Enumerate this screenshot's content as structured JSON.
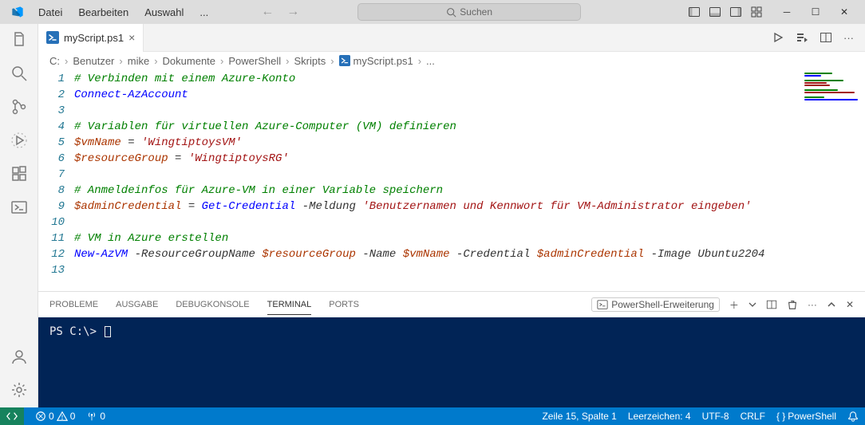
{
  "titlebar": {
    "menu": [
      "Datei",
      "Bearbeiten",
      "Auswahl",
      "..."
    ],
    "search": "Suchen"
  },
  "tab": {
    "filename": "myScript.ps1"
  },
  "breadcrumb": {
    "parts": [
      "C:",
      "Benutzer",
      "mike",
      "Dokumente",
      "PowerShell",
      "Skripts",
      "myScript.ps1",
      "..."
    ]
  },
  "code": {
    "lines": [
      {
        "n": 1,
        "tokens": [
          {
            "t": "# Verbinden mit einem Azure-Konto",
            "c": "tok-comment"
          }
        ]
      },
      {
        "n": 2,
        "tokens": [
          {
            "t": "Connect-AzAccount",
            "c": "tok-cmdlet"
          }
        ]
      },
      {
        "n": 3,
        "tokens": []
      },
      {
        "n": 4,
        "tokens": [
          {
            "t": "# Variablen für virtuellen Azure-Computer (VM) definieren",
            "c": "tok-comment"
          }
        ]
      },
      {
        "n": 5,
        "tokens": [
          {
            "t": "$vmName",
            "c": "tok-var"
          },
          {
            "t": " = ",
            "c": "tok-op"
          },
          {
            "t": "'WingtiptoysVM'",
            "c": "tok-string"
          }
        ]
      },
      {
        "n": 6,
        "tokens": [
          {
            "t": "$resourceGroup",
            "c": "tok-var"
          },
          {
            "t": " = ",
            "c": "tok-op"
          },
          {
            "t": "'WingtiptoysRG'",
            "c": "tok-string"
          }
        ]
      },
      {
        "n": 7,
        "tokens": []
      },
      {
        "n": 8,
        "tokens": [
          {
            "t": "# Anmeldeinfos für Azure-VM in einer Variable speichern",
            "c": "tok-comment"
          }
        ]
      },
      {
        "n": 9,
        "tokens": [
          {
            "t": "$adminCredential",
            "c": "tok-var"
          },
          {
            "t": " = ",
            "c": "tok-op"
          },
          {
            "t": "Get-Credential",
            "c": "tok-cmdlet"
          },
          {
            "t": " -",
            "c": "tok-op"
          },
          {
            "t": "Meldung ",
            "c": "tok-param"
          },
          {
            "t": "'Benutzernamen und Kennwort für VM-Administrator eingeben'",
            "c": "tok-string"
          }
        ]
      },
      {
        "n": 10,
        "tokens": []
      },
      {
        "n": 11,
        "tokens": [
          {
            "t": "# VM in Azure erstellen",
            "c": "tok-comment"
          }
        ]
      },
      {
        "n": 12,
        "tokens": [
          {
            "t": "New-AzVM",
            "c": "tok-cmdlet"
          },
          {
            "t": " -",
            "c": "tok-op"
          },
          {
            "t": "ResourceGroupName ",
            "c": "tok-param"
          },
          {
            "t": "$resourceGroup",
            "c": "tok-var"
          },
          {
            "t": " -",
            "c": "tok-op"
          },
          {
            "t": "Name ",
            "c": "tok-param"
          },
          {
            "t": "$vmName",
            "c": "tok-var"
          },
          {
            "t": " -",
            "c": "tok-op"
          },
          {
            "t": "Credential ",
            "c": "tok-param"
          },
          {
            "t": "$adminCredential",
            "c": "tok-var"
          },
          {
            "t": " -",
            "c": "tok-op"
          },
          {
            "t": "Image Ubuntu2204",
            "c": "tok-param"
          }
        ]
      },
      {
        "n": 13,
        "tokens": []
      }
    ]
  },
  "panel": {
    "tabs": [
      "PROBLEME",
      "AUSGABE",
      "DEBUGKONSOLE",
      "TERMINAL",
      "PORTS"
    ],
    "active": "TERMINAL",
    "terminal_label": "PowerShell-Erweiterung",
    "terminal_prompt": "PS C:\\> "
  },
  "statusbar": {
    "errors": "0",
    "warnings": "0",
    "ports": "0",
    "cursor": "Zeile 15, Spalte 1",
    "spaces": "Leerzeichen: 4",
    "encoding": "UTF-8",
    "eol": "CRLF",
    "lang": "PowerShell"
  }
}
